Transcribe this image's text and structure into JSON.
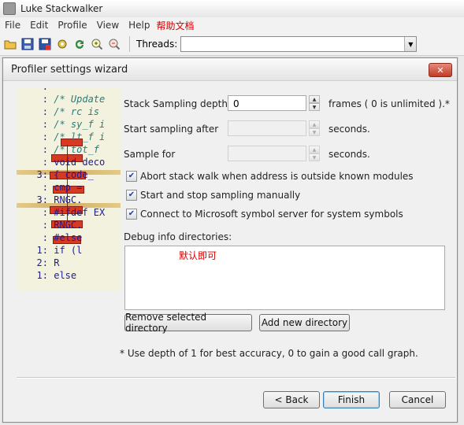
{
  "window": {
    "title": "Luke Stackwalker"
  },
  "menu": [
    "File",
    "Edit",
    "Profile",
    "View",
    "Help"
  ],
  "menu_extra": "帮助文档",
  "toolbar": {
    "threads_label": "Threads:",
    "threads_value": ""
  },
  "dialog": {
    "title": "Profiler settings wizard",
    "stack_depth_label": "Stack Sampling depth:",
    "stack_depth_value": "0",
    "frames_note": "frames ( 0 is unlimited ).*",
    "start_after_label": "Start sampling after",
    "start_after_value": "",
    "start_after_unit": "seconds.",
    "sample_for_label": "Sample for",
    "sample_for_value": "",
    "sample_for_unit": "seconds.",
    "checks": [
      {
        "label": "Abort stack walk when address is outside known modules",
        "checked": true
      },
      {
        "label": "Start and stop sampling manually",
        "checked": true
      },
      {
        "label": "Connect to Microsoft symbol server for system symbols",
        "checked": true
      }
    ],
    "debug_label": "Debug info directories:",
    "debug_note": "默认即可",
    "remove_btn": "Remove selected directory",
    "add_btn": "Add new directory",
    "hint": "* Use depth of 1 for best accuracy, 0 to gain a good call graph.",
    "back_btn": "< Back",
    "finish_btn": "Finish",
    "cancel_btn": "Cancel"
  },
  "code_preview": [
    {
      "num": ":",
      "text": "",
      "cls": ""
    },
    {
      "num": ":",
      "text": "/* Update",
      "cls": "comment"
    },
    {
      "num": ":",
      "text": "/* rc is",
      "cls": "comment"
    },
    {
      "num": ":",
      "text": "/* sy_f i",
      "cls": "comment"
    },
    {
      "num": ":",
      "text": "/* lt_f i",
      "cls": "comment"
    },
    {
      "num": ":",
      "text": "/* tot_f",
      "cls": "comment"
    },
    {
      "num": ":",
      "text": "void deco",
      "cls": "kw"
    },
    {
      "num": "3:",
      "text": "{  code_",
      "cls": ""
    },
    {
      "num": ":",
      "text": "   cmp =",
      "cls": ""
    },
    {
      "num": "3:",
      "text": "   RNGC.",
      "cls": ""
    },
    {
      "num": ":",
      "text": "#ifdef EX",
      "cls": ""
    },
    {
      "num": ":",
      "text": "   RNGC.",
      "cls": ""
    },
    {
      "num": ":",
      "text": "#else",
      "cls": "kw"
    },
    {
      "num": "1:",
      "text": "    if (l",
      "cls": "kw"
    },
    {
      "num": "2:",
      "text": "       R",
      "cls": ""
    },
    {
      "num": "1:",
      "text": "    else",
      "cls": "kw"
    }
  ]
}
